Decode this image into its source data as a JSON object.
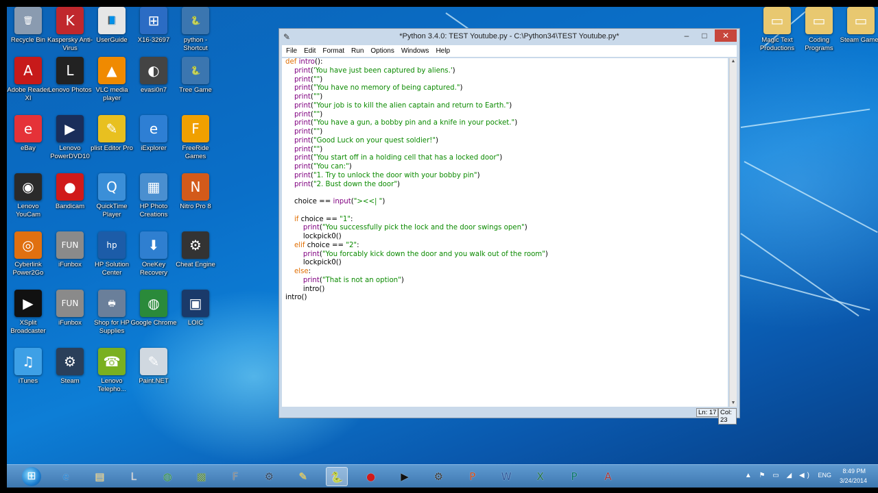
{
  "window": {
    "title": "*Python 3.4.0: TEST Youtube.py - C:\\Python34\\TEST Youtube.py*",
    "menu": [
      "File",
      "Edit",
      "Format",
      "Run",
      "Options",
      "Windows",
      "Help"
    ],
    "status": {
      "line": "Ln: 17",
      "col": "Col: 23"
    },
    "buttons": {
      "minimize": "–",
      "maximize": "□",
      "close": "✕"
    }
  },
  "code_lines": [
    [
      [
        "kw",
        "def "
      ],
      [
        "bi",
        "intro"
      ],
      [
        "",
        "():"
      ]
    ],
    [
      [
        "",
        "    "
      ],
      [
        "bi",
        "print"
      ],
      [
        "",
        "("
      ],
      [
        "st",
        "'You have just been captured by aliens.'"
      ],
      [
        "",
        ")"
      ]
    ],
    [
      [
        "",
        "    "
      ],
      [
        "bi",
        "print"
      ],
      [
        "",
        "("
      ],
      [
        "st",
        "\"\""
      ],
      [
        "",
        ")"
      ]
    ],
    [
      [
        "",
        "    "
      ],
      [
        "bi",
        "print"
      ],
      [
        "",
        "("
      ],
      [
        "st",
        "\"You have no memory of being captured.\""
      ],
      [
        "",
        ")"
      ]
    ],
    [
      [
        "",
        "    "
      ],
      [
        "bi",
        "print"
      ],
      [
        "",
        "("
      ],
      [
        "st",
        "\"\""
      ],
      [
        "",
        ")"
      ]
    ],
    [
      [
        "",
        "    "
      ],
      [
        "bi",
        "print"
      ],
      [
        "",
        "("
      ],
      [
        "st",
        "\"Your job is to kill the alien captain and return to Earth.\""
      ],
      [
        "",
        ")"
      ]
    ],
    [
      [
        "",
        "    "
      ],
      [
        "bi",
        "print"
      ],
      [
        "",
        "("
      ],
      [
        "st",
        "\"\""
      ],
      [
        "",
        ")"
      ]
    ],
    [
      [
        "",
        "    "
      ],
      [
        "bi",
        "print"
      ],
      [
        "",
        "("
      ],
      [
        "st",
        "\"You have a gun, a bobby pin and a knife in your pocket.\""
      ],
      [
        "",
        ")"
      ]
    ],
    [
      [
        "",
        "    "
      ],
      [
        "bi",
        "print"
      ],
      [
        "",
        "("
      ],
      [
        "st",
        "\"\""
      ],
      [
        "",
        ")"
      ]
    ],
    [
      [
        "",
        "    "
      ],
      [
        "bi",
        "print"
      ],
      [
        "",
        "("
      ],
      [
        "st",
        "\"Good Luck on your quest soldier!\""
      ],
      [
        "",
        ")"
      ]
    ],
    [
      [
        "",
        "    "
      ],
      [
        "bi",
        "print"
      ],
      [
        "",
        "("
      ],
      [
        "st",
        "\"\""
      ],
      [
        "",
        ")"
      ]
    ],
    [
      [
        "",
        "    "
      ],
      [
        "bi",
        "print"
      ],
      [
        "",
        "("
      ],
      [
        "st",
        "\"You start off in a holding cell that has a locked door\""
      ],
      [
        "",
        ")"
      ]
    ],
    [
      [
        "",
        "    "
      ],
      [
        "bi",
        "print"
      ],
      [
        "",
        "("
      ],
      [
        "st",
        "\"You can:\""
      ],
      [
        "",
        ")"
      ]
    ],
    [
      [
        "",
        "    "
      ],
      [
        "bi",
        "print"
      ],
      [
        "",
        "("
      ],
      [
        "st",
        "\"1. Try to unlock the door with your bobby pin\""
      ],
      [
        "",
        ")"
      ]
    ],
    [
      [
        "",
        "    "
      ],
      [
        "bi",
        "print"
      ],
      [
        "",
        "("
      ],
      [
        "st",
        "\"2. Bust down the door\""
      ],
      [
        "",
        ")"
      ]
    ],
    [
      [
        "",
        ""
      ]
    ],
    [
      [
        "",
        "    choice == "
      ],
      [
        "bi",
        "input"
      ],
      [
        "",
        "("
      ],
      [
        "st",
        "\"><<| \""
      ],
      [
        "",
        ")"
      ]
    ],
    [
      [
        "",
        ""
      ]
    ],
    [
      [
        "",
        "    "
      ],
      [
        "kw",
        "if"
      ],
      [
        "",
        " choice == "
      ],
      [
        "st",
        "\"1\""
      ],
      [
        "",
        ":"
      ]
    ],
    [
      [
        "",
        "        "
      ],
      [
        "bi",
        "print"
      ],
      [
        "",
        "("
      ],
      [
        "st",
        "\"You successfully pick the lock and the door swings open\""
      ],
      [
        "",
        ")"
      ]
    ],
    [
      [
        "",
        "        lockpick0()"
      ]
    ],
    [
      [
        "",
        "    "
      ],
      [
        "kw",
        "elif"
      ],
      [
        "",
        " choice == "
      ],
      [
        "st",
        "\"2\""
      ],
      [
        "",
        ":"
      ]
    ],
    [
      [
        "",
        "        "
      ],
      [
        "bi",
        "print"
      ],
      [
        "",
        "("
      ],
      [
        "st",
        "\"You forcably kick down the door and you walk out of the room\""
      ],
      [
        "",
        ")"
      ]
    ],
    [
      [
        "",
        "        lockpick0()"
      ]
    ],
    [
      [
        "",
        "    "
      ],
      [
        "kw",
        "else"
      ],
      [
        "",
        ":"
      ]
    ],
    [
      [
        "",
        "        "
      ],
      [
        "bi",
        "print"
      ],
      [
        "",
        "("
      ],
      [
        "st",
        "\"That is not an option\""
      ],
      [
        "",
        ")"
      ]
    ],
    [
      [
        "",
        "        intro()"
      ]
    ],
    [
      [
        "",
        "intro()"
      ]
    ]
  ],
  "desktop_icons": [
    {
      "label": "Recycle Bin",
      "icon": "recycle-bin-icon",
      "glyph": "🗑",
      "color": "#8a9bb0"
    },
    {
      "label": "Kaspersky Anti-Virus",
      "icon": "kaspersky-icon",
      "glyph": "K",
      "color": "#c0282d"
    },
    {
      "label": "UserGuide",
      "icon": "userguide-icon",
      "glyph": "📘",
      "color": "#e6e6e6"
    },
    {
      "label": "X16-32697",
      "icon": "x16-folder-icon",
      "glyph": "⊞",
      "color": "#2b6cc4"
    },
    {
      "label": "python - Shortcut",
      "icon": "python-icon",
      "glyph": "🐍",
      "color": "#3b76b0"
    },
    {
      "label": "Adobe Reader XI",
      "icon": "adobe-reader-icon",
      "glyph": "A",
      "color": "#c71a1a"
    },
    {
      "label": "Lenovo Photos",
      "icon": "lenovo-photos-icon",
      "glyph": "L",
      "color": "#222222"
    },
    {
      "label": "VLC media player",
      "icon": "vlc-icon",
      "glyph": "▲",
      "color": "#f08a00"
    },
    {
      "label": "evasi0n7",
      "icon": "evasi0n-icon",
      "glyph": "◐",
      "color": "#444444"
    },
    {
      "label": "Tree Game",
      "icon": "tree-game-icon",
      "glyph": "🐍",
      "color": "#3b76b0"
    },
    {
      "label": "eBay",
      "icon": "ebay-icon",
      "glyph": "e",
      "color": "#e53238"
    },
    {
      "label": "Lenovo PowerDVD10",
      "icon": "powerdvd-icon",
      "glyph": "▶",
      "color": "#1a2e5a"
    },
    {
      "label": "plist Editor Pro",
      "icon": "plist-editor-icon",
      "glyph": "✎",
      "color": "#e8c020"
    },
    {
      "label": "iExplorer",
      "icon": "iexplorer-icon",
      "glyph": "e",
      "color": "#2e7fd4"
    },
    {
      "label": "FreeRide Games",
      "icon": "freeride-icon",
      "glyph": "F",
      "color": "#f0a000"
    },
    {
      "label": "Lenovo YouCam",
      "icon": "youcam-icon",
      "glyph": "◉",
      "color": "#2a2a2a"
    },
    {
      "label": "Bandicam",
      "icon": "bandicam-icon",
      "glyph": "●",
      "color": "#d01a1a"
    },
    {
      "label": "QuickTime Player",
      "icon": "quicktime-icon",
      "glyph": "Q",
      "color": "#3b8fd8"
    },
    {
      "label": "HP Photo Creations",
      "icon": "hp-photo-icon",
      "glyph": "▦",
      "color": "#4a8fd0"
    },
    {
      "label": "Nitro Pro 8",
      "icon": "nitro-icon",
      "glyph": "N",
      "color": "#d35a1a"
    },
    {
      "label": "Cyberlink Power2Go",
      "icon": "power2go-icon",
      "glyph": "◎",
      "color": "#e07010"
    },
    {
      "label": "iFunbox",
      "icon": "ifunbox-icon",
      "glyph": "FUN",
      "color": "#8a8a8a"
    },
    {
      "label": "HP Solution Center",
      "icon": "hp-solution-icon",
      "glyph": "hp",
      "color": "#1c5ca8"
    },
    {
      "label": "OneKey Recovery",
      "icon": "onekey-icon",
      "glyph": "⬇",
      "color": "#2f7fd0"
    },
    {
      "label": "Cheat Engine",
      "icon": "cheat-engine-icon",
      "glyph": "⚙",
      "color": "#333333"
    },
    {
      "label": "XSplit Broadcaster",
      "icon": "xsplit-icon",
      "glyph": "▶",
      "color": "#111111"
    },
    {
      "label": "iFunbox",
      "icon": "ifunbox-icon-2",
      "glyph": "FUN",
      "color": "#8a8a8a"
    },
    {
      "label": "Shop for HP Supplies",
      "icon": "hp-shop-icon",
      "glyph": "🖶",
      "color": "#6a7f9a"
    },
    {
      "label": "Google Chrome",
      "icon": "chrome-icon",
      "glyph": "◍",
      "color": "#2a8a3a"
    },
    {
      "label": "LOIC",
      "icon": "loic-icon",
      "glyph": "▣",
      "color": "#1a3a6a"
    },
    {
      "label": "iTunes",
      "icon": "itunes-icon",
      "glyph": "♫",
      "color": "#3ea0e6"
    },
    {
      "label": "Steam",
      "icon": "steam-icon",
      "glyph": "⚙",
      "color": "#2a3f5a"
    },
    {
      "label": "Lenovo Telepho...",
      "icon": "lenovo-telephony-icon",
      "glyph": "☎",
      "color": "#7ab020"
    },
    {
      "label": "Paint.NET",
      "icon": "paintnet-icon",
      "glyph": "✎",
      "color": "#d0d8e0"
    },
    {
      "label": "Magic Text Productions",
      "icon": "folder-icon",
      "glyph": "▭",
      "color": "#e8c870"
    },
    {
      "label": "Coding Programs",
      "icon": "folder-icon-2",
      "glyph": "▭",
      "color": "#e8c870"
    },
    {
      "label": "Steam Games",
      "icon": "folder-icon-3",
      "glyph": "▭",
      "color": "#e8c870"
    }
  ],
  "taskbar": {
    "apps": [
      {
        "name": "ie-icon",
        "glyph": "e",
        "color": "#1e7fd1"
      },
      {
        "name": "file-explorer-icon",
        "glyph": "▤",
        "color": "#e8c870"
      },
      {
        "name": "lenovo-app-icon",
        "glyph": "L",
        "color": "#d0d0d0"
      },
      {
        "name": "chrome-taskbar-icon",
        "glyph": "◍",
        "color": "#2a8a3a"
      },
      {
        "name": "minecraft-icon",
        "glyph": "▩",
        "color": "#5a8a3a"
      },
      {
        "name": "ifunbox-taskbar-icon",
        "glyph": "F",
        "color": "#888888"
      },
      {
        "name": "steam-taskbar-icon",
        "glyph": "⚙",
        "color": "#2a3f5a"
      },
      {
        "name": "notes-taskbar-icon",
        "glyph": "✎",
        "color": "#e8c020"
      },
      {
        "name": "python-idle-taskbar-icon",
        "glyph": "🐍",
        "color": "#3b76b0"
      },
      {
        "name": "bandicam-taskbar-icon",
        "glyph": "●",
        "color": "#d01a1a"
      },
      {
        "name": "xsplit-taskbar-icon",
        "glyph": "▶",
        "color": "#111111"
      },
      {
        "name": "cheat-engine-taskbar-icon",
        "glyph": "⚙",
        "color": "#333333"
      },
      {
        "name": "powerpoint-taskbar-icon",
        "glyph": "P",
        "color": "#c84a1c"
      },
      {
        "name": "word-taskbar-icon",
        "glyph": "W",
        "color": "#2a5699"
      },
      {
        "name": "excel-taskbar-icon",
        "glyph": "X",
        "color": "#207245"
      },
      {
        "name": "publisher-taskbar-icon",
        "glyph": "P",
        "color": "#077568"
      },
      {
        "name": "access-taskbar-icon",
        "glyph": "A",
        "color": "#a4373a"
      }
    ],
    "tray_icons": "▲ ⚑ ▭ ◢ ◀)",
    "language": "ENG",
    "time": "8:49 PM",
    "date": "3/24/2014"
  }
}
